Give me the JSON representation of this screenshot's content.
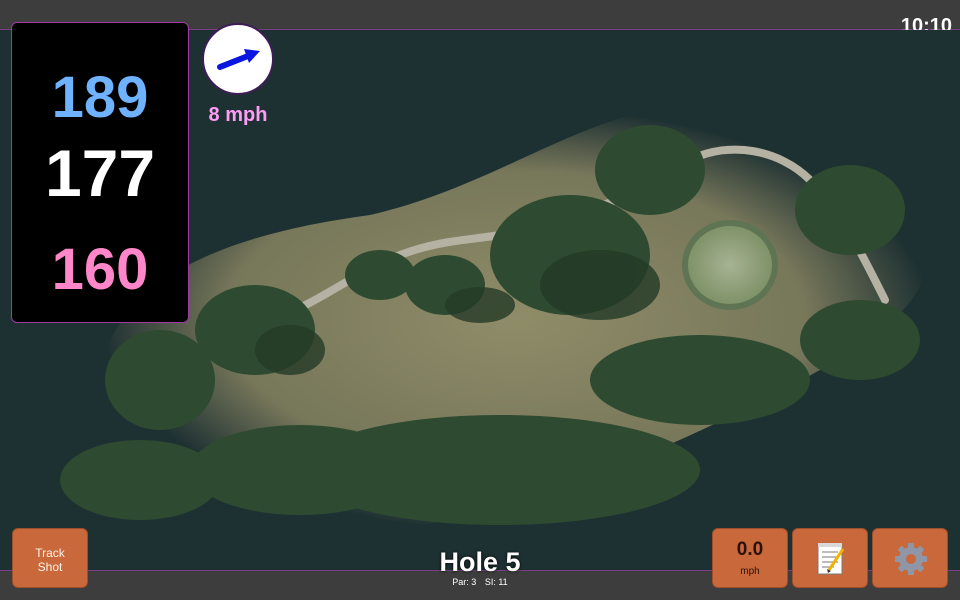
{
  "status_bar": {
    "time": "10:10"
  },
  "distances": {
    "back": "189",
    "middle": "177",
    "front": "160"
  },
  "wind": {
    "speed": "8 mph",
    "direction_icon": "wind-arrow-icon"
  },
  "hole": {
    "title": "Hole 5",
    "par": "Par: 3",
    "stroke_index": "SI: 11"
  },
  "buttons": {
    "track_line1": "Track",
    "track_line2": "Shot",
    "speed_value": "0.0",
    "speed_unit": "mph",
    "notes_icon": "notepad-icon",
    "settings_icon": "gear-icon"
  },
  "colors": {
    "back_distance": "#6fb2ff",
    "middle_distance": "#ffffff",
    "front_distance": "#ff86c9",
    "wind_text": "#ff9cf5",
    "button": "#c8683b",
    "accent_border": "#a23aa6"
  }
}
